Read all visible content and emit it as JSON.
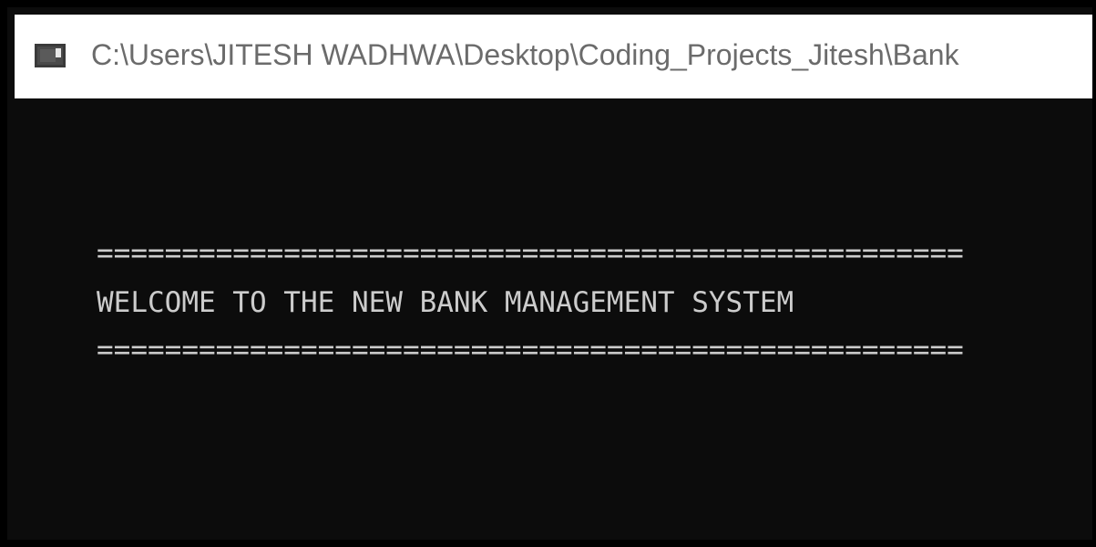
{
  "window": {
    "title": "C:\\Users\\JITESH WADHWA\\Desktop\\Coding_Projects_Jitesh\\Bank",
    "icon": "console-app-icon"
  },
  "console": {
    "rule_top": "===================================================",
    "banner": "WELCOME TO THE NEW BANK MANAGEMENT SYSTEM",
    "rule_bottom": "==================================================="
  },
  "colors": {
    "console_background": "#0c0c0c",
    "console_text": "#cccccc",
    "titlebar_background": "#ffffff",
    "titlebar_text": "#6b6b6b"
  }
}
